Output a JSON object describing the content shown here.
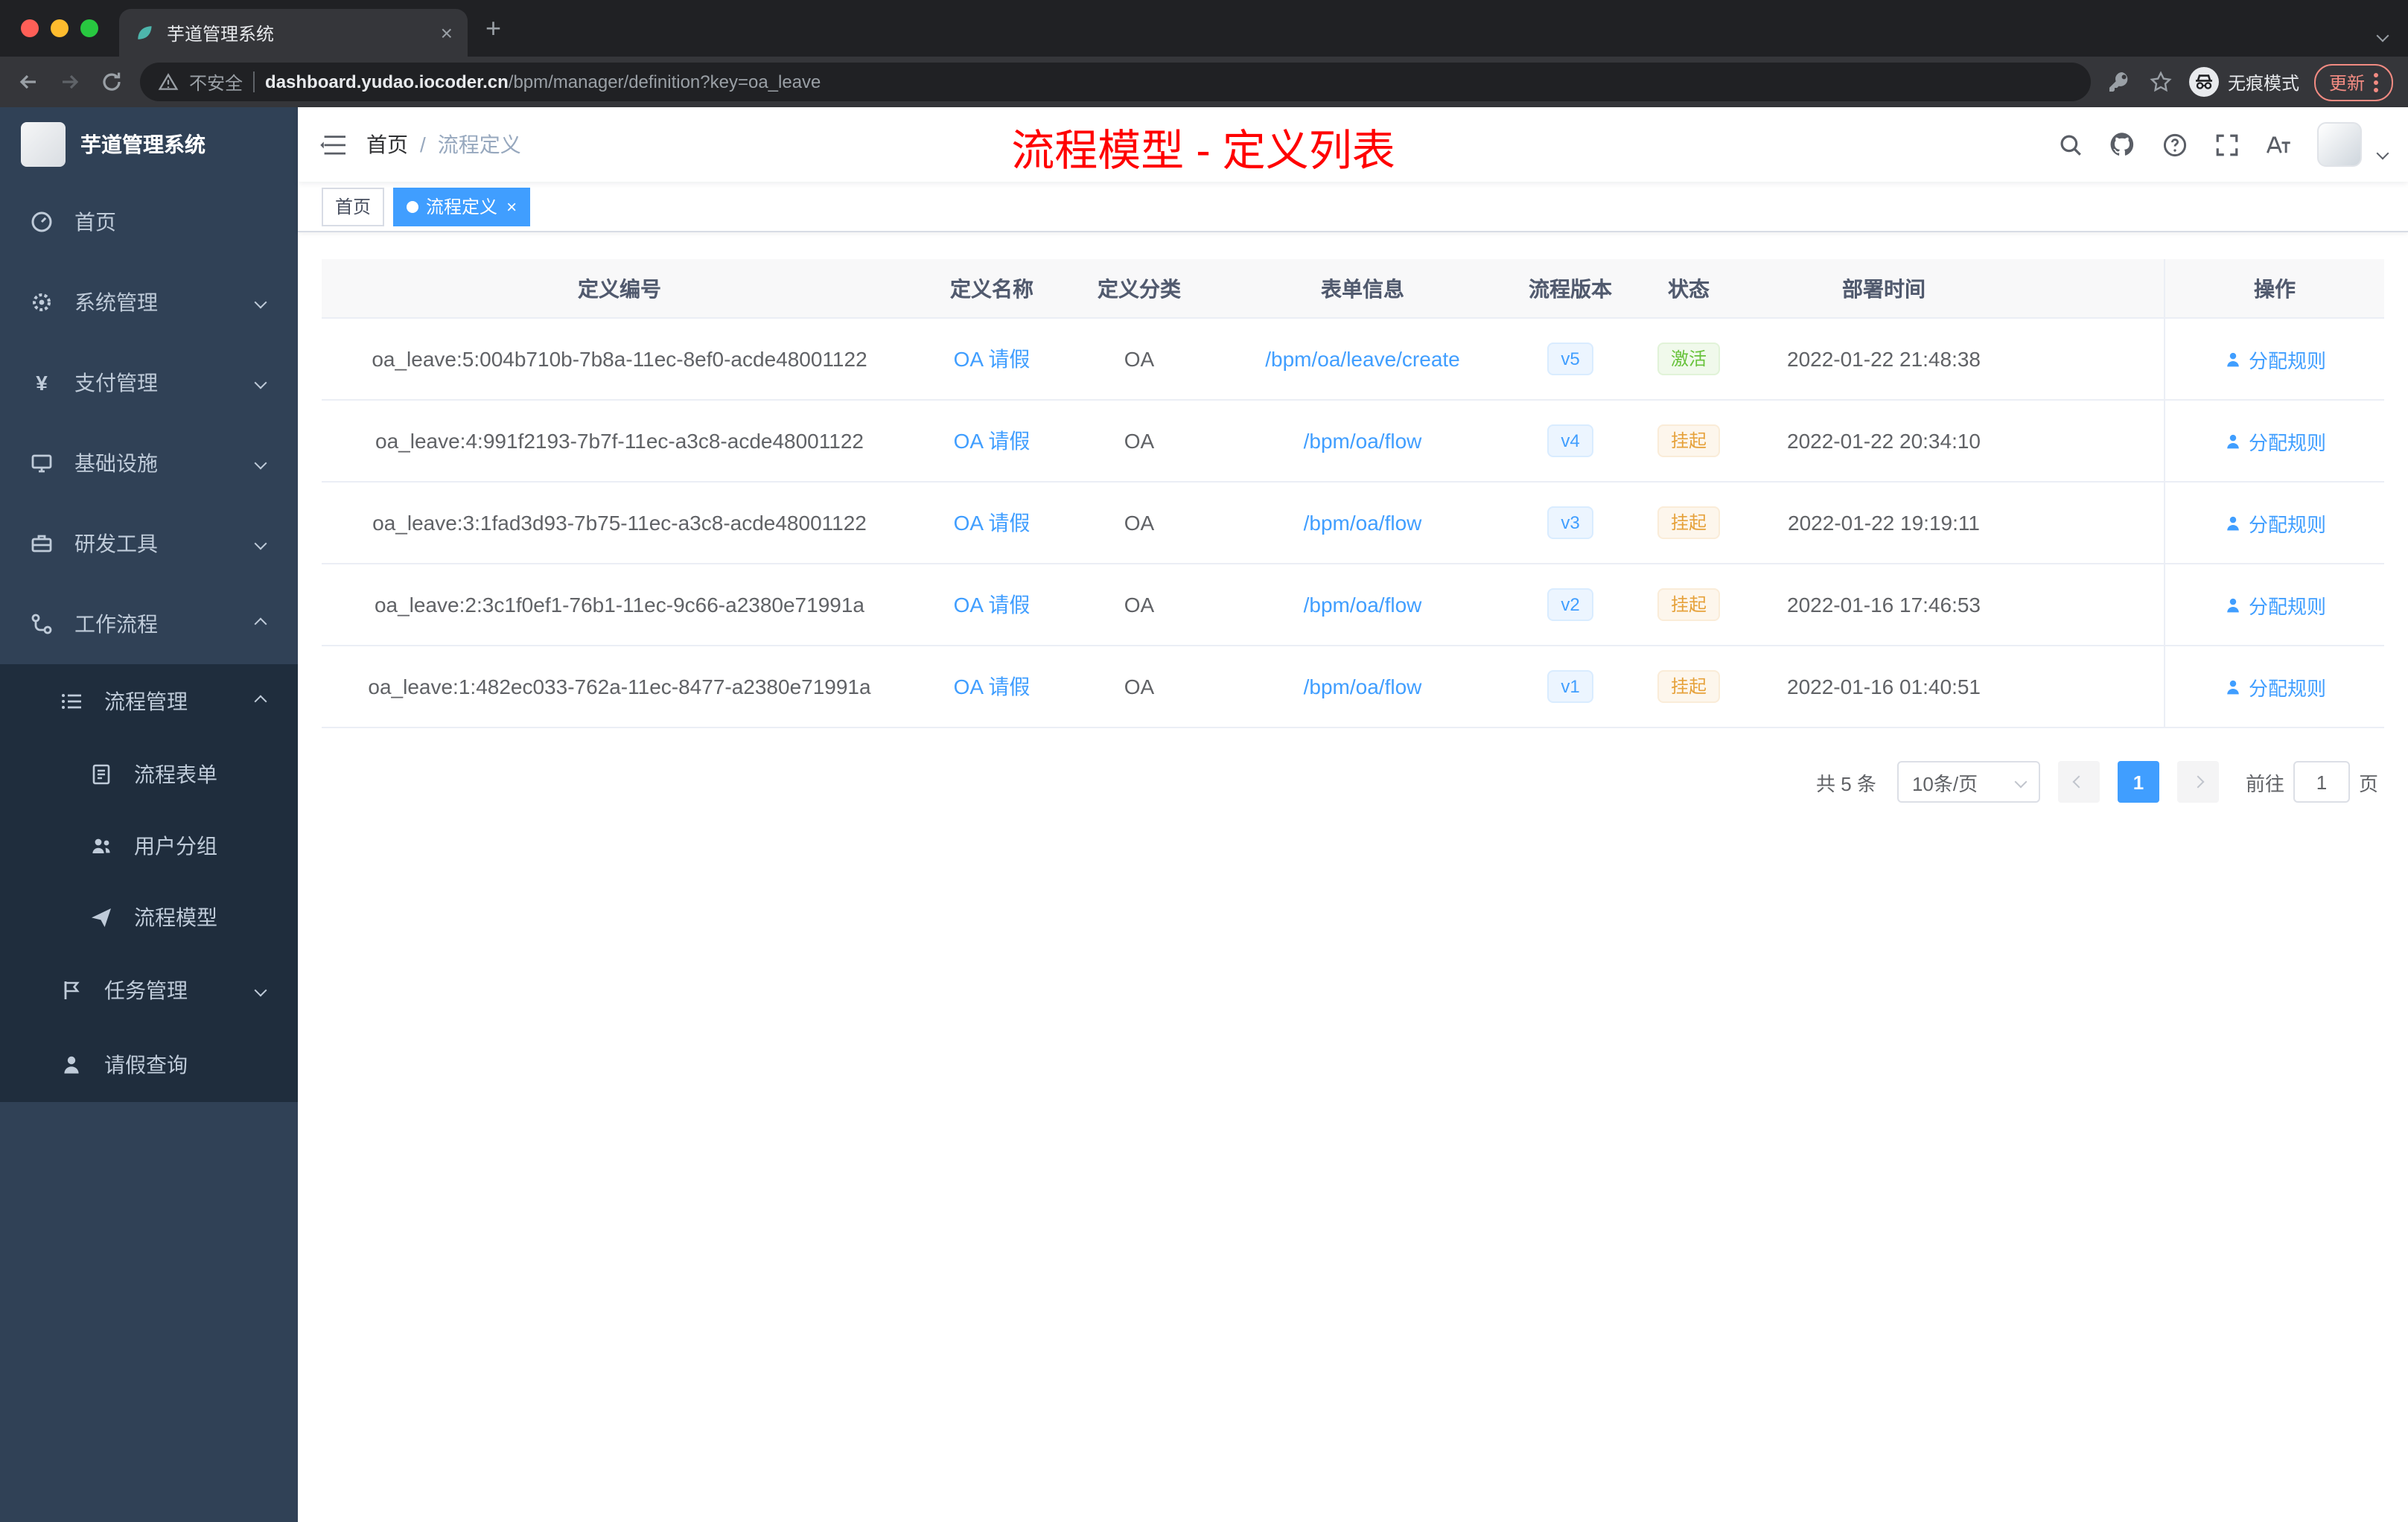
{
  "browser": {
    "tab": {
      "title": "芋道管理系统"
    },
    "address": {
      "security_label": "不安全",
      "url_host": "dashboard.yudao.iocoder.cn",
      "url_path": "/bpm/manager/definition?key=oa_leave"
    },
    "incognito_label": "无痕模式",
    "update_label": "更新"
  },
  "sidebar": {
    "app_title": "芋道管理系统",
    "items": [
      {
        "label": "首页"
      },
      {
        "label": "系统管理"
      },
      {
        "label": "支付管理"
      },
      {
        "label": "基础设施"
      },
      {
        "label": "研发工具"
      },
      {
        "label": "工作流程"
      },
      {
        "label": "流程管理"
      },
      {
        "label": "流程表单"
      },
      {
        "label": "用户分组"
      },
      {
        "label": "流程模型"
      },
      {
        "label": "任务管理"
      },
      {
        "label": "请假查询"
      }
    ]
  },
  "navbar": {
    "breadcrumb": {
      "home": "首页",
      "separator": "/",
      "current": "流程定义"
    },
    "overlay_title": "流程模型 - 定义列表"
  },
  "tags": {
    "home": "首页",
    "active": "流程定义",
    "close": "×"
  },
  "table": {
    "columns": [
      "定义编号",
      "定义名称",
      "定义分类",
      "表单信息",
      "流程版本",
      "状态",
      "部署时间",
      "操作"
    ],
    "rows": [
      {
        "id": "oa_leave:5:004b710b-7b8a-11ec-8ef0-acde48001122",
        "name": "OA 请假",
        "category": "OA",
        "form": "/bpm/oa/leave/create",
        "version": "v5",
        "status": "激活",
        "status_type": "success",
        "time": "2022-01-22 21:48:38",
        "action": "分配规则"
      },
      {
        "id": "oa_leave:4:991f2193-7b7f-11ec-a3c8-acde48001122",
        "name": "OA 请假",
        "category": "OA",
        "form": "/bpm/oa/flow",
        "version": "v4",
        "status": "挂起",
        "status_type": "warning",
        "time": "2022-01-22 20:34:10",
        "action": "分配规则"
      },
      {
        "id": "oa_leave:3:1fad3d93-7b75-11ec-a3c8-acde48001122",
        "name": "OA 请假",
        "category": "OA",
        "form": "/bpm/oa/flow",
        "version": "v3",
        "status": "挂起",
        "status_type": "warning",
        "time": "2022-01-22 19:19:11",
        "action": "分配规则"
      },
      {
        "id": "oa_leave:2:3c1f0ef1-76b1-11ec-9c66-a2380e71991a",
        "name": "OA 请假",
        "category": "OA",
        "form": "/bpm/oa/flow",
        "version": "v2",
        "status": "挂起",
        "status_type": "warning",
        "time": "2022-01-16 17:46:53",
        "action": "分配规则"
      },
      {
        "id": "oa_leave:1:482ec033-762a-11ec-8477-a2380e71991a",
        "name": "OA 请假",
        "category": "OA",
        "form": "/bpm/oa/flow",
        "version": "v1",
        "status": "挂起",
        "status_type": "warning",
        "time": "2022-01-16 01:40:51",
        "action": "分配规则"
      }
    ]
  },
  "pagination": {
    "total": "共 5 条",
    "page_size": "10条/页",
    "page": "1",
    "goto_label": "前往",
    "goto_value": "1",
    "unit": "页"
  },
  "colors": {
    "accent_blue": "#409eff",
    "success_green": "#67c23a",
    "warning_orange": "#e6a23c",
    "sidebar_bg": "#304156",
    "sidebar_sub_bg": "#1f2d3d",
    "title_red": "#ff0000"
  }
}
